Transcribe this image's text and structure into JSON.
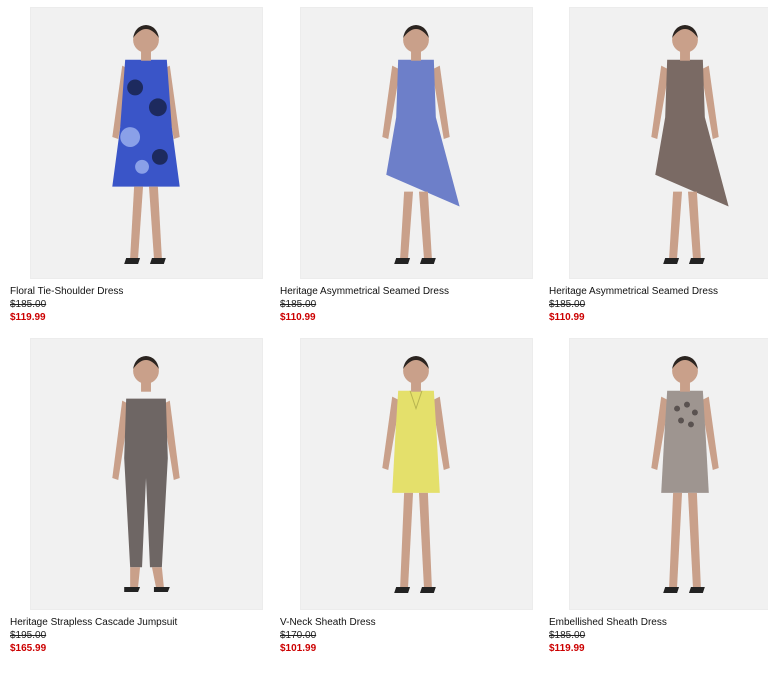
{
  "colors": {
    "sale_price": "#cc0000",
    "image_bg": "#f1f1f1"
  },
  "products": [
    {
      "name": "Floral Tie-Shoulder Dress",
      "original_price": "$185.00",
      "sale_price": "$119.99",
      "garment_color": "#3a55c8",
      "pattern": "floral"
    },
    {
      "name": "Heritage Asymmetrical Seamed Dress",
      "original_price": "$185.00",
      "sale_price": "$110.99",
      "garment_color": "#6d7fc9",
      "pattern": "asymmetrical"
    },
    {
      "name": "Heritage Asymmetrical Seamed Dress",
      "original_price": "$185.00",
      "sale_price": "$110.99",
      "garment_color": "#7a6a64",
      "pattern": "asymmetrical"
    },
    {
      "name": "Heritage Strapless Cascade Jumpsuit",
      "original_price": "$195.00",
      "sale_price": "$165.99",
      "garment_color": "#6e6664",
      "pattern": "jumpsuit"
    },
    {
      "name": "V-Neck Sheath Dress",
      "original_price": "$170.00",
      "sale_price": "$101.99",
      "garment_color": "#e4e06b",
      "pattern": "sheath"
    },
    {
      "name": "Embellished Sheath Dress",
      "original_price": "$185.00",
      "sale_price": "$119.99",
      "garment_color": "#9e9590",
      "pattern": "embellished"
    }
  ]
}
